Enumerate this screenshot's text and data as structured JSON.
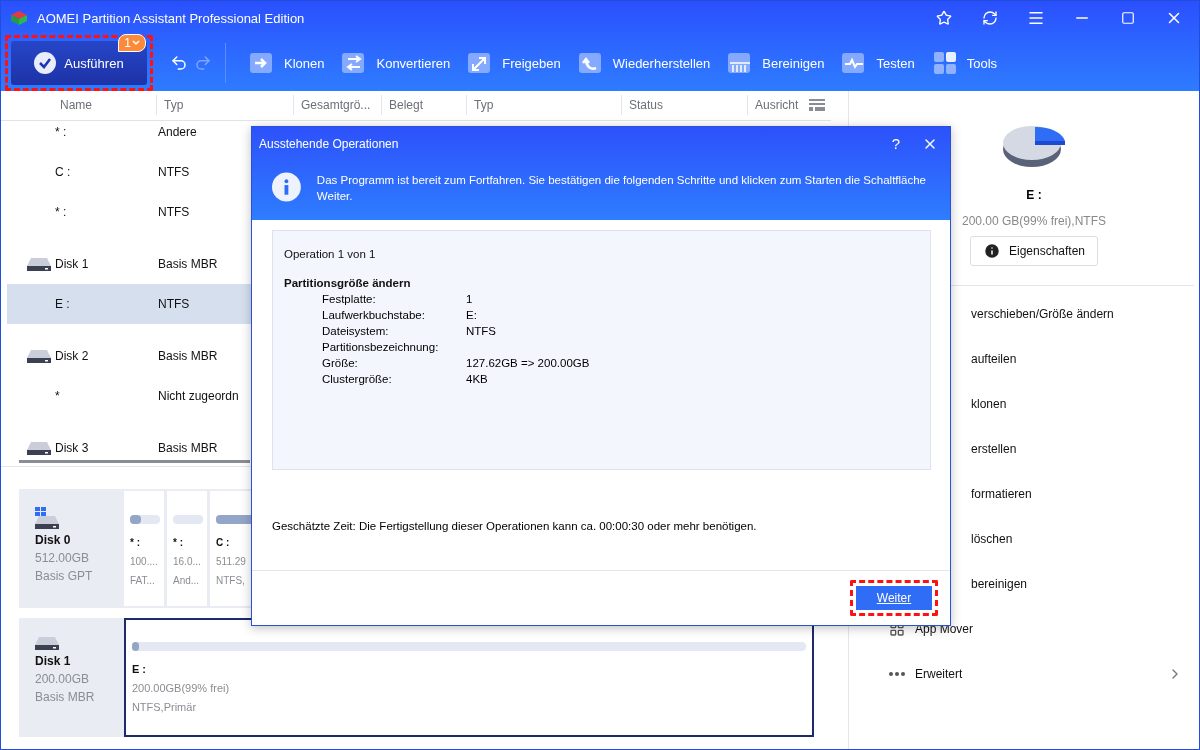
{
  "window": {
    "title": "AOMEI Partition Assistant Professional Edition"
  },
  "toolbar": {
    "execute": {
      "label": "Ausführen",
      "badge": "1",
      "highlighted": true
    },
    "tools": [
      {
        "label": "Klonen",
        "kind": "clone"
      },
      {
        "label": "Konvertieren",
        "kind": "convert"
      },
      {
        "label": "Freigeben",
        "kind": "expand"
      },
      {
        "label": "Wiederherstellen",
        "kind": "restore"
      },
      {
        "label": "Bereinigen",
        "kind": "wipe"
      },
      {
        "label": "Testen",
        "kind": "test"
      },
      {
        "label": "Tools",
        "kind": "tools"
      }
    ]
  },
  "table": {
    "columns": [
      "Name",
      "Typ",
      "Gesamtgrö...",
      "Belegt",
      "Typ",
      "Status",
      "Ausricht"
    ],
    "rows": [
      {
        "kind": "partition",
        "name": "* :",
        "type": "Andere",
        "selected": false
      },
      {
        "kind": "partition",
        "name": "C :",
        "type": "NTFS",
        "selected": false
      },
      {
        "kind": "partition",
        "name": "* :",
        "type": "NTFS",
        "selected": false
      },
      {
        "kind": "disk",
        "name": "Disk 1",
        "type": "Basis MBR",
        "selected": false
      },
      {
        "kind": "partition",
        "name": "E :",
        "type": "NTFS",
        "selected": true
      },
      {
        "kind": "disk",
        "name": "Disk 2",
        "type": "Basis MBR",
        "selected": false
      },
      {
        "kind": "partition",
        "name": "*",
        "type": "Nicht zugeordn",
        "selected": false
      },
      {
        "kind": "disk",
        "name": "Disk 3",
        "type": "Basis MBR",
        "selected": false
      }
    ]
  },
  "disk_map": [
    {
      "kind": "system",
      "name": "Disk 0",
      "size": "512.00GB",
      "style": "Basis GPT",
      "partitions": [
        {
          "letter": "* :",
          "size": "100....",
          "info": "FAT...",
          "level": 0.35,
          "selected": false
        },
        {
          "letter": "* :",
          "size": "16.0...",
          "info": "And...",
          "selected": false
        },
        {
          "letter": "C :",
          "size": "511.29",
          "info": "NTFS,",
          "level": 0.7,
          "selected": false
        }
      ]
    },
    {
      "kind": "data",
      "name": "Disk 1",
      "size": "200.00GB",
      "style": "Basis MBR",
      "partitions": [
        {
          "letter": "E :",
          "size": "200.00GB(99% frei)",
          "info": "NTFS,Primär",
          "level": 0.01,
          "selected": true
        }
      ]
    }
  ],
  "side_panel": {
    "partition": "E :",
    "details": "200.00 GB(99% frei),NTFS",
    "properties_button": "Eigenschaften",
    "actions": [
      {
        "kind": "clipped",
        "label": "verschieben/Größe ändern"
      },
      {
        "kind": "clipped",
        "label": "aufteilen"
      },
      {
        "kind": "clipped",
        "label": "klonen"
      },
      {
        "kind": "clipped",
        "label": "erstellen"
      },
      {
        "kind": "clipped",
        "label": "formatieren"
      },
      {
        "kind": "clipped",
        "label": "löschen"
      },
      {
        "kind": "clipped",
        "label": "bereinigen"
      },
      {
        "kind": "apps",
        "label": "App Mover"
      },
      {
        "kind": "more",
        "label": "Erweitert"
      }
    ]
  },
  "dialog": {
    "title": "Ausstehende Operationen",
    "help": "?",
    "info": "Das Programm ist bereit zum Fortfahren. Sie bestätigen die folgenden Schritte und klicken zum Starten die Schaltfläche Weiter.",
    "counter": "Operation 1 von 1",
    "operation": "Partitionsgröße ändern",
    "details": [
      {
        "label": "Festplatte:",
        "value": "1"
      },
      {
        "label": "Laufwerkbuchstabe:",
        "value": "E:"
      },
      {
        "label": "Dateisystem:",
        "value": "NTFS"
      },
      {
        "label": "Partitionsbezeichnung:"
      },
      {
        "label": "Größe:",
        "value": "127.62GB => 200.00GB"
      },
      {
        "label": "Clustergröße:",
        "value": "4KB"
      }
    ],
    "estimate": "Geschätzte Zeit: Die Fertigstellung dieser Operationen kann ca. 00:00:30 oder mehr benötigen.",
    "confirm_button": {
      "label": "Weiter",
      "highlighted": true
    }
  }
}
